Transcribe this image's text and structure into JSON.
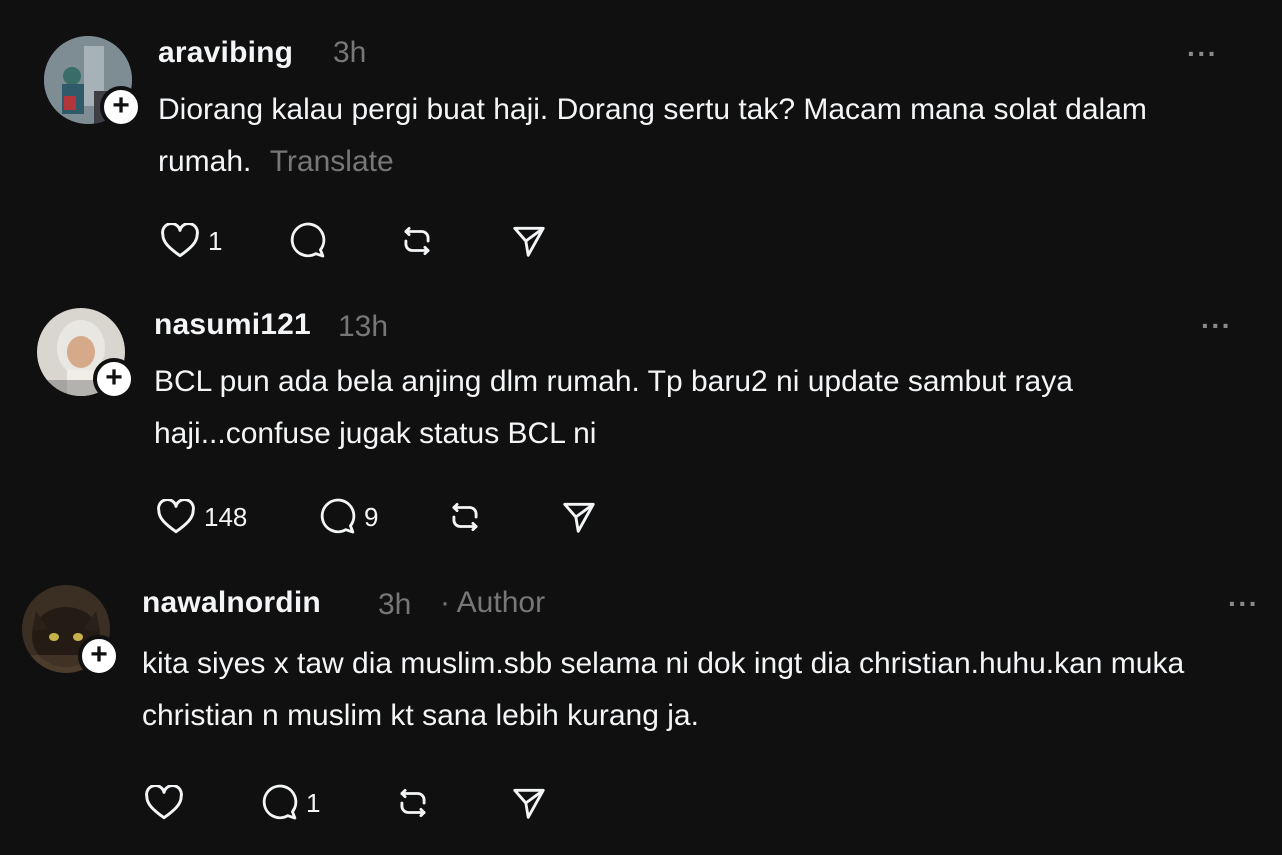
{
  "colors": {
    "background": "#101010",
    "text": "#f3f5f7",
    "muted": "#777777"
  },
  "posts": [
    {
      "username": "aravibing",
      "time": "3h",
      "text": "Diorang kalau pergi buat haji. Dorang sertu tak? Macam mana solat dalam rumah.",
      "translate": "Translate",
      "likes": "1",
      "replies": "",
      "avatar_icon": "user-avatar"
    },
    {
      "username": "nasumi121",
      "time": "13h",
      "text": "BCL pun ada bela anjing dlm rumah. Tp baru2 ni update sambut raya haji...confuse jugak status BCL ni",
      "likes": "148",
      "replies": "9",
      "avatar_icon": "user-avatar"
    },
    {
      "username": "nawalnordin",
      "time": "3h",
      "author_tag": "· Author",
      "text": "kita siyes x taw dia muslim.sbb selama ni dok ingt dia christian.huhu.kan muka christian n muslim kt sana lebih kurang ja.",
      "likes": "",
      "replies": "1",
      "avatar_icon": "cat-avatar"
    }
  ],
  "icons": {
    "more": "more-icon",
    "like": "heart-icon",
    "reply": "comment-icon",
    "repost": "repost-icon",
    "share": "send-icon",
    "follow": "plus-icon"
  },
  "more_label": "···",
  "follow_label": "+"
}
